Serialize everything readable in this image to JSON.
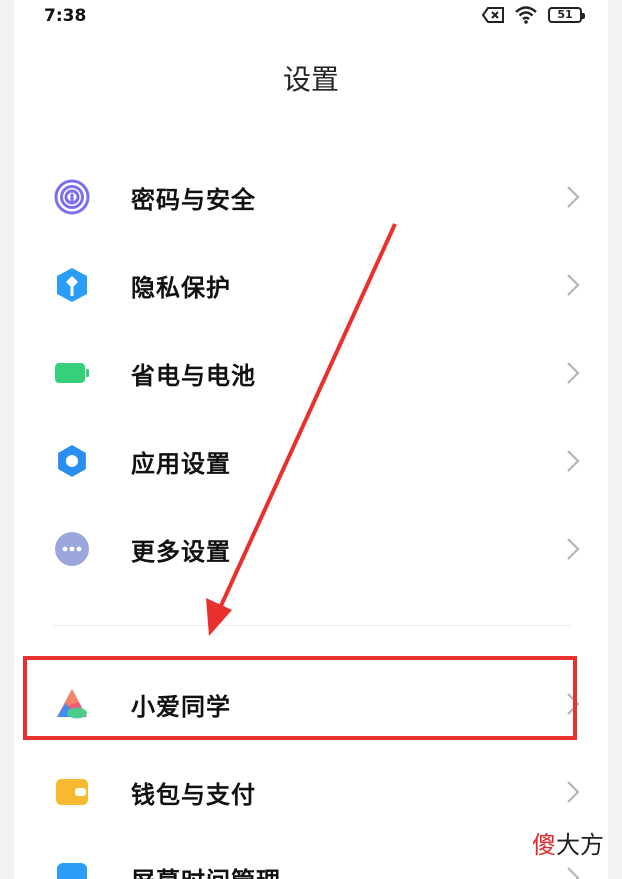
{
  "status_bar": {
    "time": "7:38",
    "battery_level": "51"
  },
  "page": {
    "title": "设置"
  },
  "menu_items": [
    {
      "label": "密码与安全",
      "icon": "fingerprint-icon",
      "color": "#7b6ff0"
    },
    {
      "label": "隐私保护",
      "icon": "privacy-shield-icon",
      "color": "#2a9df4"
    },
    {
      "label": "省电与电池",
      "icon": "battery-icon",
      "color": "#36d07a"
    },
    {
      "label": "应用设置",
      "icon": "gear-icon",
      "color": "#2a8ef0"
    },
    {
      "label": "更多设置",
      "icon": "more-dots-icon",
      "color": "#9aa6dc"
    },
    {
      "label": "小爱同学",
      "icon": "xiaoai-icon",
      "color": "#f15a75"
    },
    {
      "label": "钱包与支付",
      "icon": "wallet-icon",
      "color": "#f6b92f"
    },
    {
      "label": "屏幕时间管理",
      "icon": "screen-time-icon",
      "color": "#2a9df4"
    }
  ],
  "annotation": {
    "highlight_color": "#e8312f"
  },
  "watermark": {
    "part1": "傻",
    "part2": "大方"
  }
}
